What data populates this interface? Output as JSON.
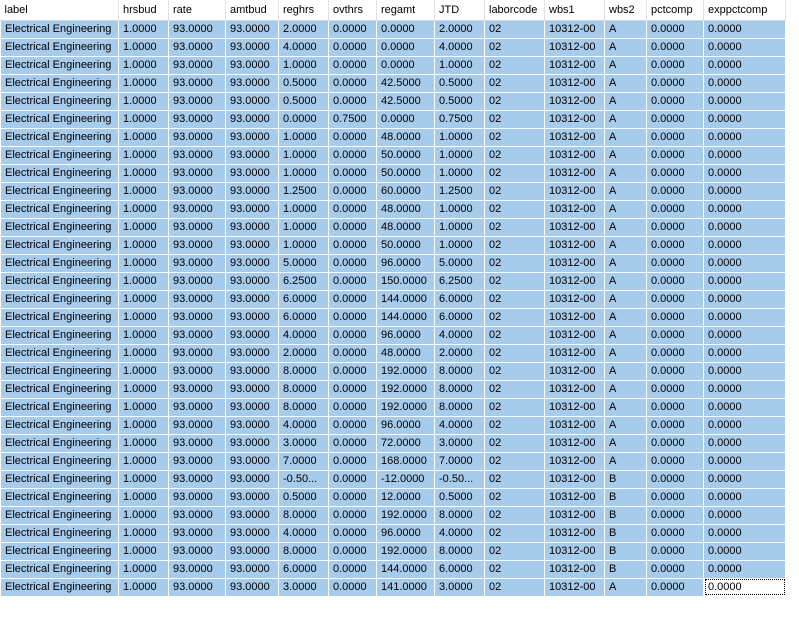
{
  "grid": {
    "columns": [
      "label",
      "hrsbud",
      "rate",
      "amtbud",
      "reghrs",
      "ovthrs",
      "regamt",
      "JTD",
      "laborcode",
      "wbs1",
      "wbs2",
      "pctcomp",
      "exppctcomp"
    ],
    "rows": [
      [
        "Electrical Engineering",
        "1.0000",
        "93.0000",
        "93.0000",
        "2.0000",
        "0.0000",
        "0.0000",
        "2.0000",
        "02",
        "10312-00",
        "A",
        "0.0000",
        "0.0000"
      ],
      [
        "Electrical Engineering",
        "1.0000",
        "93.0000",
        "93.0000",
        "4.0000",
        "0.0000",
        "0.0000",
        "4.0000",
        "02",
        "10312-00",
        "A",
        "0.0000",
        "0.0000"
      ],
      [
        "Electrical Engineering",
        "1.0000",
        "93.0000",
        "93.0000",
        "1.0000",
        "0.0000",
        "0.0000",
        "1.0000",
        "02",
        "10312-00",
        "A",
        "0.0000",
        "0.0000"
      ],
      [
        "Electrical Engineering",
        "1.0000",
        "93.0000",
        "93.0000",
        "0.5000",
        "0.0000",
        "42.5000",
        "0.5000",
        "02",
        "10312-00",
        "A",
        "0.0000",
        "0.0000"
      ],
      [
        "Electrical Engineering",
        "1.0000",
        "93.0000",
        "93.0000",
        "0.5000",
        "0.0000",
        "42.5000",
        "0.5000",
        "02",
        "10312-00",
        "A",
        "0.0000",
        "0.0000"
      ],
      [
        "Electrical Engineering",
        "1.0000",
        "93.0000",
        "93.0000",
        "0.0000",
        "0.7500",
        "0.0000",
        "0.7500",
        "02",
        "10312-00",
        "A",
        "0.0000",
        "0.0000"
      ],
      [
        "Electrical Engineering",
        "1.0000",
        "93.0000",
        "93.0000",
        "1.0000",
        "0.0000",
        "48.0000",
        "1.0000",
        "02",
        "10312-00",
        "A",
        "0.0000",
        "0.0000"
      ],
      [
        "Electrical Engineering",
        "1.0000",
        "93.0000",
        "93.0000",
        "1.0000",
        "0.0000",
        "50.0000",
        "1.0000",
        "02",
        "10312-00",
        "A",
        "0.0000",
        "0.0000"
      ],
      [
        "Electrical Engineering",
        "1.0000",
        "93.0000",
        "93.0000",
        "1.0000",
        "0.0000",
        "50.0000",
        "1.0000",
        "02",
        "10312-00",
        "A",
        "0.0000",
        "0.0000"
      ],
      [
        "Electrical Engineering",
        "1.0000",
        "93.0000",
        "93.0000",
        "1.2500",
        "0.0000",
        "60.0000",
        "1.2500",
        "02",
        "10312-00",
        "A",
        "0.0000",
        "0.0000"
      ],
      [
        "Electrical Engineering",
        "1.0000",
        "93.0000",
        "93.0000",
        "1.0000",
        "0.0000",
        "48.0000",
        "1.0000",
        "02",
        "10312-00",
        "A",
        "0.0000",
        "0.0000"
      ],
      [
        "Electrical Engineering",
        "1.0000",
        "93.0000",
        "93.0000",
        "1.0000",
        "0.0000",
        "48.0000",
        "1.0000",
        "02",
        "10312-00",
        "A",
        "0.0000",
        "0.0000"
      ],
      [
        "Electrical Engineering",
        "1.0000",
        "93.0000",
        "93.0000",
        "1.0000",
        "0.0000",
        "50.0000",
        "1.0000",
        "02",
        "10312-00",
        "A",
        "0.0000",
        "0.0000"
      ],
      [
        "Electrical Engineering",
        "1.0000",
        "93.0000",
        "93.0000",
        "5.0000",
        "0.0000",
        "96.0000",
        "5.0000",
        "02",
        "10312-00",
        "A",
        "0.0000",
        "0.0000"
      ],
      [
        "Electrical Engineering",
        "1.0000",
        "93.0000",
        "93.0000",
        "6.2500",
        "0.0000",
        "150.0000",
        "6.2500",
        "02",
        "10312-00",
        "A",
        "0.0000",
        "0.0000"
      ],
      [
        "Electrical Engineering",
        "1.0000",
        "93.0000",
        "93.0000",
        "6.0000",
        "0.0000",
        "144.0000",
        "6.0000",
        "02",
        "10312-00",
        "A",
        "0.0000",
        "0.0000"
      ],
      [
        "Electrical Engineering",
        "1.0000",
        "93.0000",
        "93.0000",
        "6.0000",
        "0.0000",
        "144.0000",
        "6.0000",
        "02",
        "10312-00",
        "A",
        "0.0000",
        "0.0000"
      ],
      [
        "Electrical Engineering",
        "1.0000",
        "93.0000",
        "93.0000",
        "4.0000",
        "0.0000",
        "96.0000",
        "4.0000",
        "02",
        "10312-00",
        "A",
        "0.0000",
        "0.0000"
      ],
      [
        "Electrical Engineering",
        "1.0000",
        "93.0000",
        "93.0000",
        "2.0000",
        "0.0000",
        "48.0000",
        "2.0000",
        "02",
        "10312-00",
        "A",
        "0.0000",
        "0.0000"
      ],
      [
        "Electrical Engineering",
        "1.0000",
        "93.0000",
        "93.0000",
        "8.0000",
        "0.0000",
        "192.0000",
        "8.0000",
        "02",
        "10312-00",
        "A",
        "0.0000",
        "0.0000"
      ],
      [
        "Electrical Engineering",
        "1.0000",
        "93.0000",
        "93.0000",
        "8.0000",
        "0.0000",
        "192.0000",
        "8.0000",
        "02",
        "10312-00",
        "A",
        "0.0000",
        "0.0000"
      ],
      [
        "Electrical Engineering",
        "1.0000",
        "93.0000",
        "93.0000",
        "8.0000",
        "0.0000",
        "192.0000",
        "8.0000",
        "02",
        "10312-00",
        "A",
        "0.0000",
        "0.0000"
      ],
      [
        "Electrical Engineering",
        "1.0000",
        "93.0000",
        "93.0000",
        "4.0000",
        "0.0000",
        "96.0000",
        "4.0000",
        "02",
        "10312-00",
        "A",
        "0.0000",
        "0.0000"
      ],
      [
        "Electrical Engineering",
        "1.0000",
        "93.0000",
        "93.0000",
        "3.0000",
        "0.0000",
        "72.0000",
        "3.0000",
        "02",
        "10312-00",
        "A",
        "0.0000",
        "0.0000"
      ],
      [
        "Electrical Engineering",
        "1.0000",
        "93.0000",
        "93.0000",
        "7.0000",
        "0.0000",
        "168.0000",
        "7.0000",
        "02",
        "10312-00",
        "A",
        "0.0000",
        "0.0000"
      ],
      [
        "Electrical Engineering",
        "1.0000",
        "93.0000",
        "93.0000",
        "-0.50...",
        "0.0000",
        "-12.0000",
        "-0.50...",
        "02",
        "10312-00",
        "B",
        "0.0000",
        "0.0000"
      ],
      [
        "Electrical Engineering",
        "1.0000",
        "93.0000",
        "93.0000",
        "0.5000",
        "0.0000",
        "12.0000",
        "0.5000",
        "02",
        "10312-00",
        "B",
        "0.0000",
        "0.0000"
      ],
      [
        "Electrical Engineering",
        "1.0000",
        "93.0000",
        "93.0000",
        "8.0000",
        "0.0000",
        "192.0000",
        "8.0000",
        "02",
        "10312-00",
        "B",
        "0.0000",
        "0.0000"
      ],
      [
        "Electrical Engineering",
        "1.0000",
        "93.0000",
        "93.0000",
        "4.0000",
        "0.0000",
        "96.0000",
        "4.0000",
        "02",
        "10312-00",
        "B",
        "0.0000",
        "0.0000"
      ],
      [
        "Electrical Engineering",
        "1.0000",
        "93.0000",
        "93.0000",
        "8.0000",
        "0.0000",
        "192.0000",
        "8.0000",
        "02",
        "10312-00",
        "B",
        "0.0000",
        "0.0000"
      ],
      [
        "Electrical Engineering",
        "1.0000",
        "93.0000",
        "93.0000",
        "6.0000",
        "0.0000",
        "144.0000",
        "6.0000",
        "02",
        "10312-00",
        "B",
        "0.0000",
        "0.0000"
      ],
      [
        "Electrical Engineering",
        "1.0000",
        "93.0000",
        "93.0000",
        "3.0000",
        "0.0000",
        "141.0000",
        "3.0000",
        "02",
        "10312-00",
        "A",
        "0.0000",
        "0.0000"
      ]
    ]
  },
  "colors": {
    "selection": "#a6cbeb",
    "header_bg": "#ffffff",
    "cell_border": "#ffffff"
  }
}
